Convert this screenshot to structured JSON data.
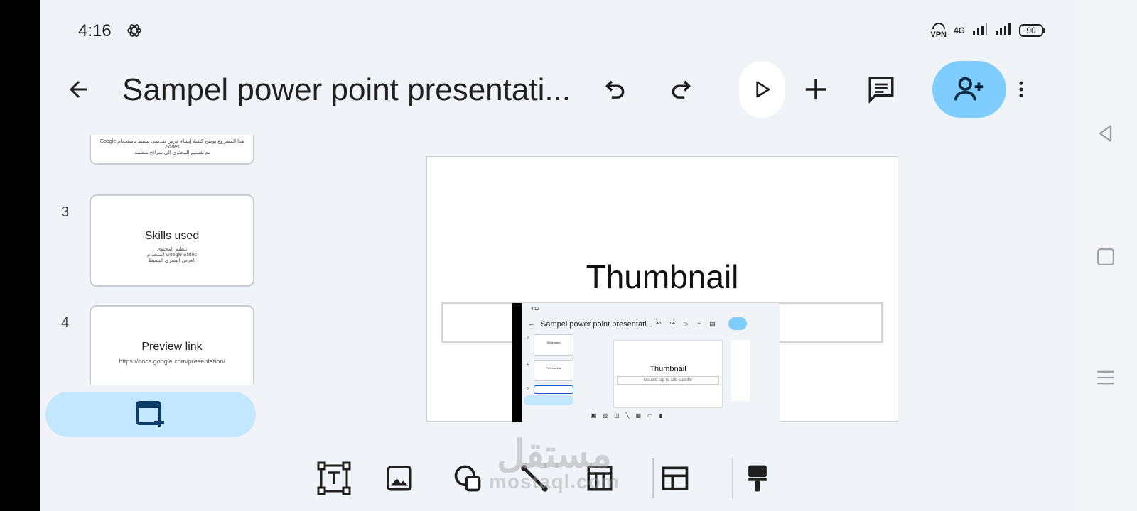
{
  "status": {
    "time": "4:16",
    "vpn": "VPN",
    "network": "4G",
    "battery": "90"
  },
  "toolbar": {
    "title": "Sampel power point presentati..."
  },
  "slides": [
    {
      "number": "",
      "text_rtl_1": "هذا المشروع يوضح كيفية إنشاء عرض تقديمي بسيط باستخدام Google Slides،",
      "text_rtl_2": "مع تقسيم المحتوى إلى شرائح منظمة."
    },
    {
      "number": "3",
      "title": "Skills used",
      "line1": "تنظيم المحتوى",
      "line2": "استخدام Google Slides",
      "line3": "العرض البصري البسيط"
    },
    {
      "number": "4",
      "title": "Preview link",
      "link": "https://docs.google.com/presentation/"
    }
  ],
  "canvas": {
    "title": "Thumbnail"
  },
  "inner_screenshot": {
    "time": "4:12",
    "title": "Sampel power point presentati...",
    "thumb1_title": "Skills used",
    "thumb2_title": "Preview link",
    "num1": "3",
    "num2": "4",
    "num3": "5",
    "canvas_title": "Thumbnail",
    "canvas_subtitle": "Double tap to add subtitle"
  },
  "watermark": {
    "arabic": "مستقل",
    "latin": "mostaql.com"
  },
  "colors": {
    "share_bg": "#7fcdff",
    "new_slide_bg": "#c2e7ff",
    "app_bg": "#f0f4f9",
    "icon_blue": "#0b57d0"
  }
}
